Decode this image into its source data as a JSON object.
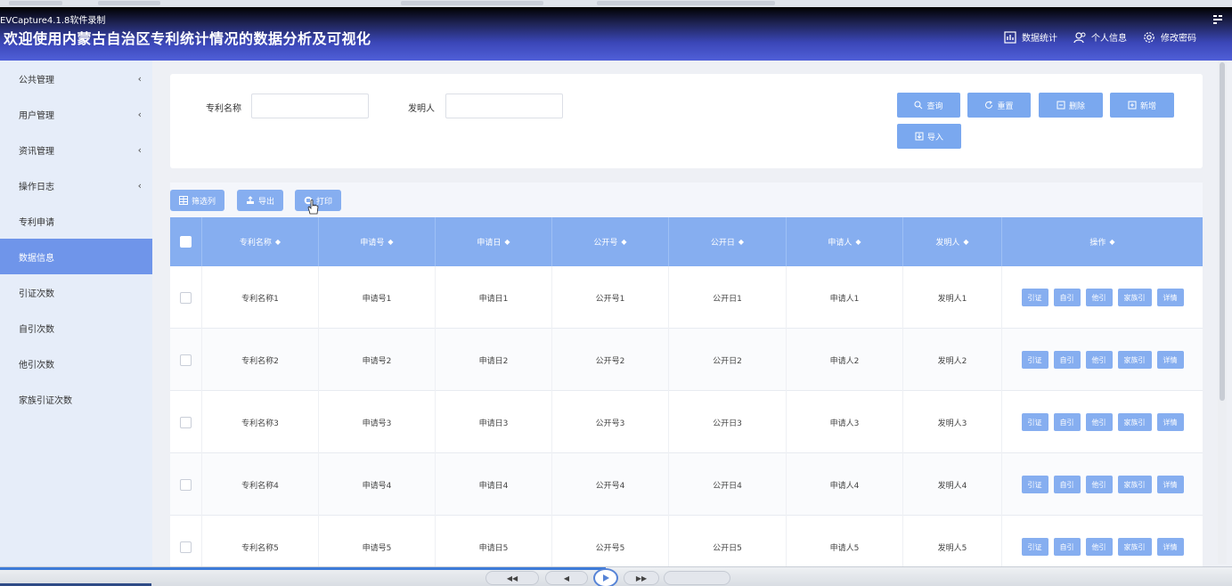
{
  "capture_label": "EVCapture4.1.8软件录制",
  "app_title": "欢迎使用内蒙古自治区专利统计情况的数据分析及可视化",
  "header_nav": [
    {
      "label": "数据统计",
      "icon": "chart-icon"
    },
    {
      "label": "个人信息",
      "icon": "user-icon"
    },
    {
      "label": "修改密码",
      "icon": "gear-icon"
    }
  ],
  "sidebar": {
    "items": [
      {
        "label": "公共管理",
        "has_chevron": true
      },
      {
        "label": "用户管理",
        "has_chevron": true
      },
      {
        "label": "资讯管理",
        "has_chevron": true
      },
      {
        "label": "操作日志",
        "has_chevron": true
      },
      {
        "label": "专利申请",
        "has_chevron": false
      },
      {
        "label": "数据信息",
        "has_chevron": false,
        "active": true
      },
      {
        "label": "引证次数",
        "has_chevron": false
      },
      {
        "label": "自引次数",
        "has_chevron": false
      },
      {
        "label": "他引次数",
        "has_chevron": false
      },
      {
        "label": "家族引证次数",
        "has_chevron": false
      }
    ]
  },
  "search": {
    "patent_name_label": "专利名称",
    "patent_name_value": "",
    "inventor_label": "发明人",
    "inventor_value": "",
    "query_label": "查询",
    "reset_label": "重置",
    "delete_label": "删除",
    "add_label": "新增",
    "import_label": "导入"
  },
  "toolbar": {
    "filter_columns_label": "筛选列",
    "export_label": "导出",
    "print_label": "打印"
  },
  "table": {
    "columns": [
      "专利名称",
      "申请号",
      "申请日",
      "公开号",
      "公开日",
      "申请人",
      "发明人",
      "操作"
    ],
    "op_labels": [
      "引证",
      "自引",
      "他引",
      "家族引",
      "详情"
    ],
    "rows": [
      [
        "专利名称1",
        "申请号1",
        "申请日1",
        "公开号1",
        "公开日1",
        "申请人1",
        "发明人1"
      ],
      [
        "专利名称2",
        "申请号2",
        "申请日2",
        "公开号2",
        "公开日2",
        "申请人2",
        "发明人2"
      ],
      [
        "专利名称3",
        "申请号3",
        "申请日3",
        "公开号3",
        "公开日3",
        "申请人3",
        "发明人3"
      ],
      [
        "专利名称4",
        "申请号4",
        "申请日4",
        "公开号4",
        "公开日4",
        "申请人4",
        "发明人4"
      ],
      [
        "专利名称5",
        "申请号5",
        "申请日5",
        "公开号5",
        "公开日5",
        "申请人5",
        "发明人5"
      ]
    ]
  },
  "colors": {
    "header_start": "#1e2353",
    "header_end": "#4f5fd8",
    "accent": "#86aef0",
    "sidebar_bg": "#e6edf9",
    "sidebar_active": "#6f95ea"
  }
}
